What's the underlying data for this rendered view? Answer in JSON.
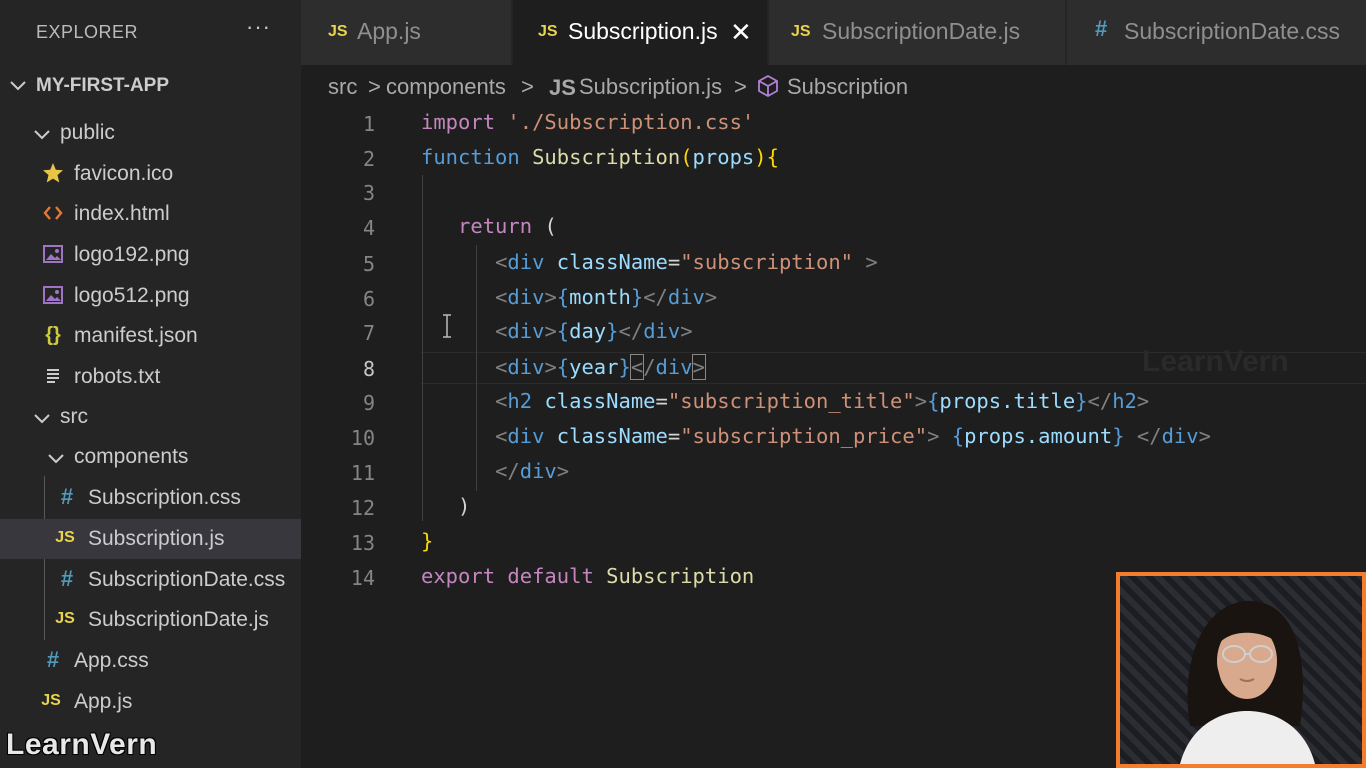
{
  "sidebar": {
    "title": "EXPLORER",
    "more_icon": "ellipsis-icon",
    "project": "MY-FIRST-APP",
    "items": [
      {
        "label": "public",
        "type": "folder"
      },
      {
        "label": "favicon.ico",
        "icon": "star-icon"
      },
      {
        "label": "index.html",
        "icon": "html-icon"
      },
      {
        "label": "logo192.png",
        "icon": "image-icon"
      },
      {
        "label": "logo512.png",
        "icon": "image-icon"
      },
      {
        "label": "manifest.json",
        "icon": "json-icon"
      },
      {
        "label": "robots.txt",
        "icon": "text-icon"
      },
      {
        "label": "src",
        "type": "folder"
      },
      {
        "label": "components",
        "type": "folder"
      },
      {
        "label": "Subscription.css",
        "icon": "css-icon"
      },
      {
        "label": "Subscription.js",
        "icon": "js-icon",
        "selected": true
      },
      {
        "label": "SubscriptionDate.css",
        "icon": "css-icon"
      },
      {
        "label": "SubscriptionDate.js",
        "icon": "js-icon"
      },
      {
        "label": "App.css",
        "icon": "css-icon"
      },
      {
        "label": "App.js",
        "icon": "js-icon"
      }
    ]
  },
  "tabs": [
    {
      "label": "App.js",
      "icon": "JS"
    },
    {
      "label": "Subscription.js",
      "icon": "JS",
      "active": true
    },
    {
      "label": "SubscriptionDate.js",
      "icon": "JS"
    },
    {
      "label": "SubscriptionDate.css",
      "icon": "#"
    }
  ],
  "tab_close_glyph": "✕",
  "breadcrumb": {
    "parts": [
      "src",
      "components",
      "Subscription.js",
      "Subscription"
    ],
    "separator": ">",
    "file_icon": "JS"
  },
  "editor": {
    "line_numbers": [
      "1",
      "2",
      "3",
      "4",
      "5",
      "6",
      "7",
      "8",
      "9",
      "10",
      "11",
      "12",
      "13",
      "14"
    ],
    "current_line": "8",
    "code": {
      "l1": {
        "kw": "import",
        "str": "'./Subscription.css'"
      },
      "l2": {
        "kw": "function",
        "fn": "Subscription",
        "open": "(",
        "param": "props",
        "close": "){"
      },
      "l4": {
        "kw": "return",
        "paren": "("
      },
      "l5": {
        "lt": "<",
        "tag": "div",
        "attr": "className",
        "eq": "=",
        "str": "\"subscription\"",
        "gt": ">"
      },
      "l6": {
        "lt": "<",
        "tag": "div",
        "gt": ">",
        "ob": "{",
        "var": "month",
        "cb": "}",
        "clt": "</",
        "ctag": "div",
        "cgt": ">"
      },
      "l7": {
        "lt": "<",
        "tag": "div",
        "gt": ">",
        "ob": "{",
        "var": "day",
        "cb": "}",
        "clt": "</",
        "ctag": "div",
        "cgt": ">"
      },
      "l8": {
        "lt": "<",
        "tag": "div",
        "gt": ">",
        "ob": "{",
        "var": "year",
        "cb": "}",
        "clt": "<",
        "slash": "/",
        "ctag": "div",
        "cgt": ">"
      },
      "l9": {
        "lt": "<",
        "tag": "h2",
        "attr": "className",
        "eq": "=",
        "str": "\"subscription_title\"",
        "gt": ">",
        "ob": "{",
        "var": "props.title",
        "cb": "}",
        "clt": "</",
        "ctag": "h2",
        "cgt": ">"
      },
      "l10": {
        "lt": "<",
        "tag": "div",
        "attr": "className",
        "eq": "=",
        "str": "\"subscription_price\"",
        "gt": ">",
        "ob": "{",
        "var": "props.amount",
        "cb": "}",
        "clt": "</",
        "ctag": "div",
        "cgt": ">"
      },
      "l11": {
        "clt": "</",
        "ctag": "div",
        "cgt": ">"
      },
      "l12": {
        "paren": ")"
      },
      "l13": {
        "brace": "}"
      },
      "l14": {
        "kw": "export",
        "kw2": "default",
        "name": "Subscription"
      }
    },
    "watermark": "LearnVern"
  },
  "brand_watermark": "LearnVern",
  "colors": {
    "accent_webcam_border": "#f47c2c",
    "js_icon": "#e8d44d",
    "css_icon": "#519aba",
    "keyword": "#c586c0",
    "string": "#ce9178"
  }
}
